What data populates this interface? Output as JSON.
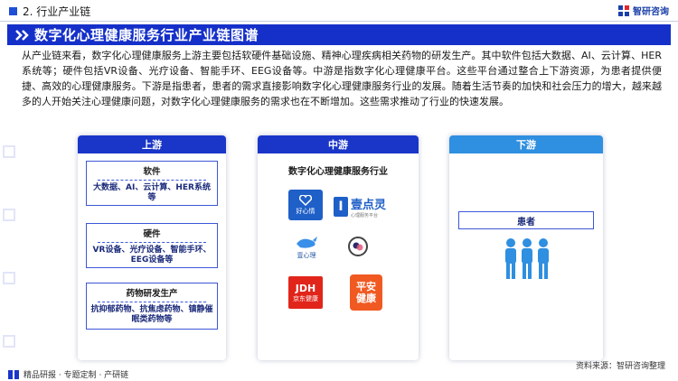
{
  "header": {
    "section_label": "2. 行业产业链",
    "brand": "智研咨询"
  },
  "banner": {
    "title": "数字化心理健康服务行业产业链图谱"
  },
  "intro": {
    "text": "从产业链来看，数字化心理健康服务上游主要包括软硬件基础设施、精神心理疾病相关药物的研发生产。其中软件包括大数据、AI、云计算、HER系统等；硬件包括VR设备、光疗设备、智能手环、EEG设备等。中游是指数字化心理健康平台。这些平台通过整合上下游资源，为患者提供便捷、高效的心理健康服务。下游是指患者，患者的需求直接影响数字化心理健康服务行业的发展。随着生活节奏的加快和社会压力的增大，越来越多的人开始关注心理健康问题，对数字化心理健康服务的需求也在不断增加。这些需求推动了行业的快速发展。"
  },
  "upstream": {
    "label": "上游",
    "boxes": [
      {
        "title": "软件",
        "body": "大数据、AI、云计算、HER系统等"
      },
      {
        "title": "硬件",
        "body": "VR设备、光疗设备、智能手环、EEG设备等"
      },
      {
        "title": "药物研发生产",
        "body": "抗抑郁药物、抗焦虑药物、镇静催眠类药物等"
      }
    ]
  },
  "midstream": {
    "label": "中游",
    "subtitle": "数字化心理健康服务行业",
    "logos": {
      "haoxinqing": "好心情",
      "yidianling_main": "壹点灵",
      "yidianling_sub": "心理服务平台",
      "yixinli": "壹心理",
      "jd": "JDH",
      "jd_sub": "京东健康",
      "pingan_line1": "平安",
      "pingan_line2": "健康"
    }
  },
  "downstream": {
    "label": "下游",
    "patient": "患者"
  },
  "footer": {
    "left": "精品研报 · 专题定制 · 产研链",
    "source": "资料来源：智研咨询整理"
  },
  "colors": {
    "primary": "#1a36c8",
    "downstream": "#2f8fe0",
    "people": "#2f8fe0",
    "pingan": "#f05a22",
    "jd": "#e1251b"
  }
}
